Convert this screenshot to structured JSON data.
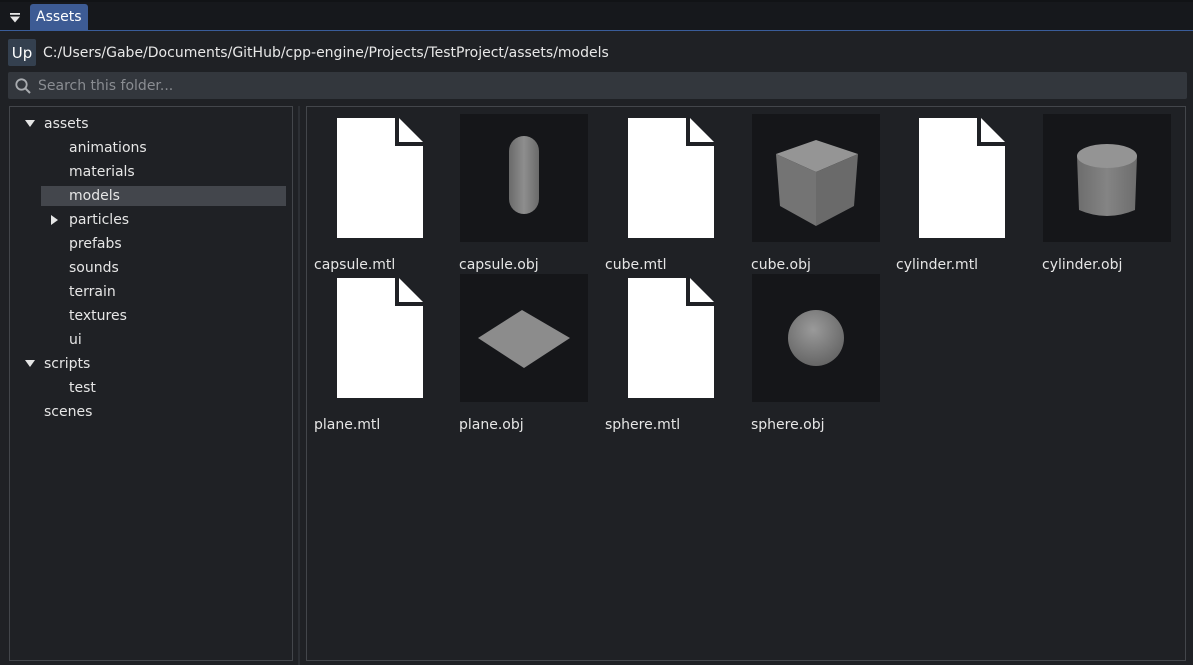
{
  "panel": {
    "tab_label": "Assets",
    "menu_icon": "triangle-down-icon"
  },
  "pathbar": {
    "up_label": "Up",
    "path": "C:/Users/Gabe/Documents/GitHub/cpp-engine/Projects/TestProject/assets/models"
  },
  "search": {
    "placeholder": "Search this folder...",
    "value": ""
  },
  "tree": [
    {
      "label": "assets",
      "expanded": true
    },
    {
      "label": "animations"
    },
    {
      "label": "materials"
    },
    {
      "label": "models",
      "selected": true
    },
    {
      "label": "particles",
      "expanded": false
    },
    {
      "label": "prefabs"
    },
    {
      "label": "sounds"
    },
    {
      "label": "terrain"
    },
    {
      "label": "textures"
    },
    {
      "label": "ui"
    },
    {
      "label": "scripts",
      "expanded": true
    },
    {
      "label": "test"
    },
    {
      "label": "scenes"
    }
  ],
  "files": [
    {
      "name": "capsule.mtl",
      "icon": "file-icon"
    },
    {
      "name": "capsule.obj",
      "icon": "capsule-thumbnail"
    },
    {
      "name": "cube.mtl",
      "icon": "file-icon"
    },
    {
      "name": "cube.obj",
      "icon": "cube-thumbnail"
    },
    {
      "name": "cylinder.mtl",
      "icon": "file-icon"
    },
    {
      "name": "cylinder.obj",
      "icon": "cylinder-thumbnail"
    },
    {
      "name": "plane.mtl",
      "icon": "file-icon"
    },
    {
      "name": "plane.obj",
      "icon": "plane-thumbnail"
    },
    {
      "name": "sphere.mtl",
      "icon": "file-icon"
    },
    {
      "name": "sphere.obj",
      "icon": "sphere-thumbnail"
    }
  ],
  "colors": {
    "accent": "#3d5b94",
    "selection": "#43464c",
    "background": "#1f2125"
  }
}
